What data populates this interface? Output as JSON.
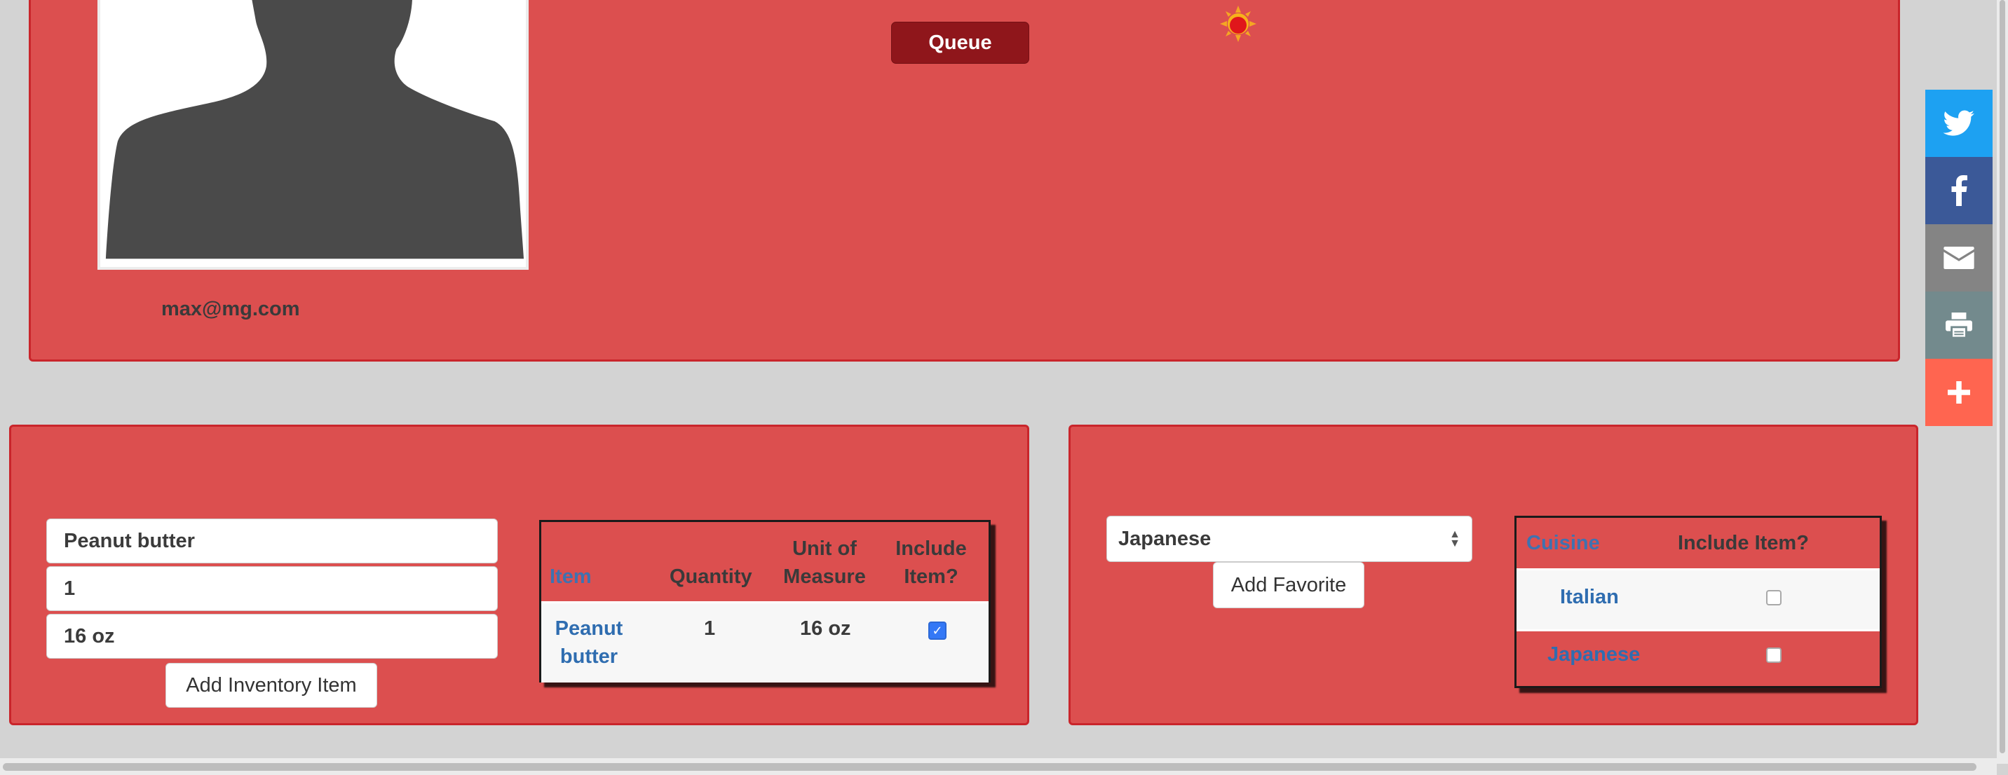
{
  "profile": {
    "email": "max@mg.com",
    "queue_label": "Queue",
    "avatar_alt": "avatar-silhouette"
  },
  "inventory": {
    "item_input_value": "Peanut butter",
    "quantity_input_value": "1",
    "unit_input_value": "16 oz",
    "add_button_label": "Add Inventory Item",
    "table": {
      "headers": {
        "item": "Item",
        "quantity": "Quantity",
        "unit_line1": "Unit of",
        "unit_line2": "Measure",
        "include_line1": "Include",
        "include_line2": "Item?"
      },
      "rows": [
        {
          "item_line1": "Peanut",
          "item_line2": "butter",
          "quantity": "1",
          "unit": "16 oz",
          "include": true
        }
      ]
    }
  },
  "favorites": {
    "select_value": "Japanese",
    "add_button_label": "Add Favorite",
    "table": {
      "headers": {
        "cuisine": "Cuisine",
        "include": "Include Item?"
      },
      "rows": [
        {
          "cuisine": "Italian",
          "include": false
        },
        {
          "cuisine": "Japanese",
          "include": false
        }
      ]
    }
  },
  "share_bar": {
    "buttons": [
      {
        "name": "twitter",
        "icon": "twitter-icon",
        "color": "#1da1f2"
      },
      {
        "name": "facebook",
        "icon": "facebook-icon",
        "color": "#3b5998"
      },
      {
        "name": "email",
        "icon": "email-icon",
        "color": "#848484"
      },
      {
        "name": "print",
        "icon": "print-icon",
        "color": "#738a8d"
      },
      {
        "name": "more",
        "icon": "plus-icon",
        "color": "#ff6550"
      }
    ]
  },
  "colors": {
    "panel_bg": "#dc4f4f",
    "panel_border": "#c9252b",
    "queue_button": "#8f161b",
    "link_blue": "#2f6db0"
  }
}
